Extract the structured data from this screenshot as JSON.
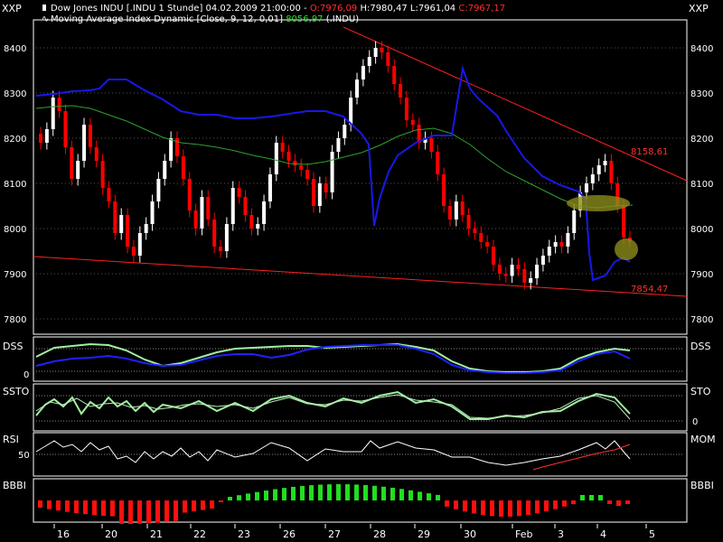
{
  "header": {
    "line1_prefix": "Dow Jones INDU [.INDU  1 Stunde] 04.02.2009 21:00:00 - ",
    "line1_open": "O:7976,09",
    "line1_high": " H:7980,47 ",
    "line1_low": "L:7961,04 ",
    "line1_close": "C:7967,17",
    "line2_prefix": "Moving Average Index Dynamic [Close, 9, 12, 0,01] ",
    "line2_value": "8056,97",
    "line2_suffix": " (.INDU)",
    "currency_left": "XXP",
    "currency_right": "XXP"
  },
  "colors": {
    "background": "#000000",
    "bull": "#ffffff",
    "bear": "#ff0000",
    "channel": "#ff0000",
    "ma_dynamic": "#1010e0",
    "ma_green": "#2ea02e",
    "highlight": "#8b8b1a",
    "histo_pos": "#22dd22",
    "histo_neg": "#ff1010"
  },
  "panel_labels": {
    "dss_left": "DSS",
    "dss_right": "DSS",
    "sto_left": "SSTO",
    "sto_right": "STO",
    "rsi_left": "RSI",
    "rsi_right": "MOM",
    "bbbi_left": "BBBI",
    "bbbi_right": "BBBI"
  },
  "chart_data": [
    {
      "type": "candlestick",
      "title": "Dow Jones INDU [.INDU  1 Stunde]",
      "ylabel": "XXP",
      "ylim": [
        7750,
        8450
      ],
      "yticks": [
        7800,
        7900,
        8000,
        8100,
        8200,
        8300,
        8400
      ],
      "x_tick_labels": [
        "16",
        "20",
        "21",
        "22",
        "23",
        "26",
        "27",
        "28",
        "29",
        "30",
        "Feb",
        "3",
        "4",
        "5"
      ],
      "closes": [
        8190,
        8220,
        8290,
        8260,
        8180,
        8110,
        8150,
        8230,
        8180,
        8150,
        8090,
        8060,
        7990,
        8030,
        7960,
        7940,
        7990,
        8010,
        8060,
        8110,
        8150,
        8200,
        8160,
        8110,
        8040,
        8000,
        8070,
        8020,
        7960,
        7950,
        8010,
        8090,
        8070,
        8030,
        8000,
        8010,
        8060,
        8120,
        8190,
        8170,
        8150,
        8140,
        8130,
        8110,
        8050,
        8100,
        8080,
        8170,
        8200,
        8230,
        8290,
        8330,
        8360,
        8380,
        8400,
        8390,
        8360,
        8320,
        8290,
        8240,
        8230,
        8190,
        8200,
        8170,
        8120,
        8050,
        8020,
        8060,
        8030,
        8000,
        7990,
        7970,
        7960,
        7920,
        7900,
        7895,
        7920,
        7910,
        7880,
        7890,
        7920,
        7940,
        7960,
        7970,
        7960,
        7990,
        8040,
        8080,
        8100,
        8120,
        8140,
        8150,
        8100,
        8050,
        7980,
        7970
      ],
      "channel_upper": {
        "label": "8158,61",
        "value": 8158.61
      },
      "channel_lower": {
        "label": "7854,47",
        "value": 7854.47
      },
      "ma_dynamic_last": 8056.97
    },
    {
      "type": "line",
      "name": "DSS",
      "ylim": [
        0,
        100
      ],
      "ytick": 0
    },
    {
      "type": "line",
      "name": "SSTO",
      "ylim": [
        0,
        100
      ],
      "ytick": 0
    },
    {
      "type": "line",
      "name": "RSI",
      "ylim": [
        0,
        100
      ],
      "ytick": 50
    },
    {
      "type": "bar",
      "name": "BBBI"
    }
  ]
}
